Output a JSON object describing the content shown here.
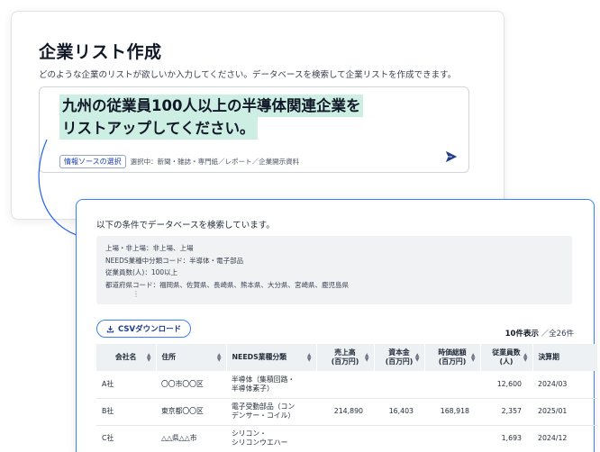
{
  "builder": {
    "title": "企業リスト作成",
    "description": "どのような企業のリストが欲しいか入力してください。データベースを検索して企業リストを作成できます。",
    "prompt_line1": "九州の従業員100人以上の半導体関連企業を",
    "prompt_line2": "リストアップしてください。",
    "source_button": "情報ソースの選択",
    "source_selected": "選択中：新聞・雑誌・専門紙／レポート／企業開示資料",
    "send_icon": "send-icon"
  },
  "results": {
    "intro": "以下の条件でデータベースを検索しています。",
    "conditions": [
      "上場・非上場：非上場、上場",
      "NEEDS業種中分類コード：半導体・電子部品",
      "従業員数(人)：100以上",
      "都道府県コード：福岡県、佐賀県、長崎県、熊本県、大分県、宮崎県、鹿児島県"
    ],
    "conditions_more": "⋮",
    "csv_button": "CSVダウンロード",
    "count_shown": "10件表示",
    "count_total": "／全26件",
    "columns": [
      {
        "label": "会社名",
        "label2": ""
      },
      {
        "label": "住所",
        "label2": ""
      },
      {
        "label": "NEEDS業種分類",
        "label2": ""
      },
      {
        "label": "売上高",
        "label2": "(百万円)"
      },
      {
        "label": "資本金",
        "label2": "(百万円)"
      },
      {
        "label": "時価総額",
        "label2": "(百万円)"
      },
      {
        "label": "従業員数",
        "label2": "(人)"
      },
      {
        "label": "決算期",
        "label2": ""
      }
    ],
    "rows": [
      {
        "company": "A社",
        "address": "〇〇市〇〇区",
        "industry1": "半導体（集積回路・",
        "industry2": "半導体素子）",
        "sales": "",
        "capital": "",
        "market_cap": "",
        "employees": "12,600",
        "fiscal": "2024/03"
      },
      {
        "company": "B社",
        "address": "東京都〇〇区",
        "industry1": "電子受動部品（コン",
        "industry2": "デンサー・コイル）",
        "sales": "214,890",
        "capital": "16,403",
        "market_cap": "168,918",
        "employees": "2,357",
        "fiscal": "2025/01"
      },
      {
        "company": "C社",
        "address": "△△県△△市",
        "industry1": "シリコン・",
        "industry2": "シリコンウエハー",
        "sales": "",
        "capital": "",
        "market_cap": "",
        "employees": "1,693",
        "fiscal": "2024/12"
      }
    ]
  }
}
